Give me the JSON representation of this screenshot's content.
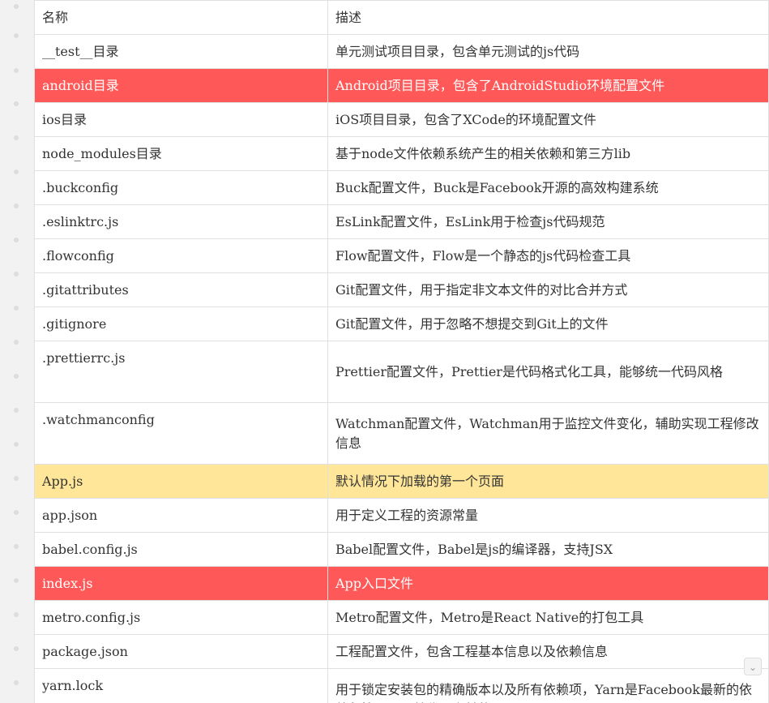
{
  "table": {
    "header": {
      "name": "名称",
      "description": "描述"
    },
    "rows": [
      {
        "name": "__test__目录",
        "description": "单元测试项目目录，包含单元测试的js代码",
        "highlight": "none"
      },
      {
        "name": "android目录",
        "description": "Android项目目录，包含了AndroidStudio环境配置文件",
        "highlight": "red"
      },
      {
        "name": "ios目录",
        "description": "iOS项目目录，包含了XCode的环境配置文件",
        "highlight": "none"
      },
      {
        "name": "node_modules目录",
        "description": "基于node文件依赖系统产生的相关依赖和第三方lib",
        "highlight": "none"
      },
      {
        "name": ".buckconfig",
        "description": "Buck配置文件，Buck是Facebook开源的高效构建系统",
        "highlight": "none"
      },
      {
        "name": ".eslinktrc.js",
        "description": "EsLink配置文件，EsLink用于检查js代码规范",
        "highlight": "none"
      },
      {
        "name": ".flowconfig",
        "description": "Flow配置文件，Flow是一个静态的js代码检查工具",
        "highlight": "none"
      },
      {
        "name": ".gitattributes",
        "description": "Git配置文件，用于指定非文本文件的对比合并方式",
        "highlight": "none"
      },
      {
        "name": ".gitignore",
        "description": "Git配置文件，用于忽略不想提交到Git上的文件",
        "highlight": "none"
      },
      {
        "name": ".prettierrc.js",
        "description": "Prettier配置文件，Prettier是代码格式化工具，能够统一代码风格",
        "highlight": "none"
      },
      {
        "name": ".watchmanconfig",
        "description": "Watchman配置文件，Watchman用于监控文件变化，辅助实现工程修改信息",
        "highlight": "none"
      },
      {
        "name": "App.js",
        "description": "默认情况下加载的第一个页面",
        "highlight": "yellow"
      },
      {
        "name": "app.json",
        "description": "用于定义工程的资源常量",
        "highlight": "none"
      },
      {
        "name": "babel.config.js",
        "description": "Babel配置文件，Babel是js的编译器，支持JSX",
        "highlight": "none"
      },
      {
        "name": "index.js",
        "description": "App入口文件",
        "highlight": "red"
      },
      {
        "name": "metro.config.js",
        "description": "Metro配置文件，Metro是React Native的打包工具",
        "highlight": "none"
      },
      {
        "name": "package.json",
        "description": "工程配置文件，包含工程基本信息以及依赖信息",
        "highlight": "none"
      },
      {
        "name": "yarn.lock",
        "description": "用于锁定安装包的精确版本以及所有依赖项，Yarn是Facebook最新的依赖包管理器，替代了之前的npm",
        "highlight": "none"
      }
    ]
  },
  "colors": {
    "highlight_red": "#ff5858",
    "highlight_yellow": "#ffe699",
    "border": "#e0e0e0",
    "text": "#333333"
  },
  "icons": {
    "scroll_chevron": "chevron-down-icon"
  }
}
